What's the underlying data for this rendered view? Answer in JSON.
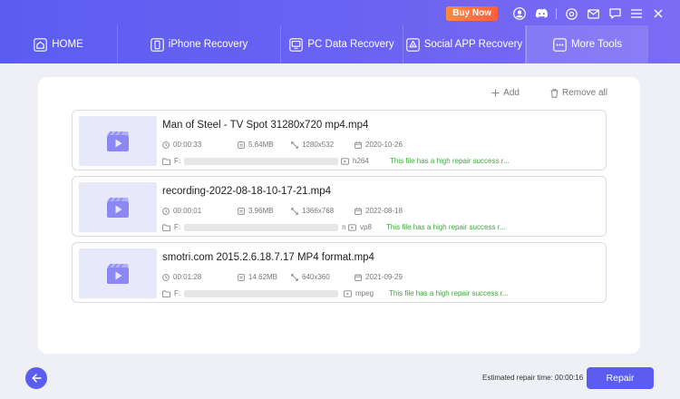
{
  "header": {
    "buy_now": "Buy Now",
    "icons": [
      "user-icon",
      "discord-icon",
      "settings-icon",
      "mail-icon",
      "feedback-icon",
      "menu-icon",
      "close-icon"
    ]
  },
  "tabs": [
    {
      "label": "HOME",
      "icon": "home-icon"
    },
    {
      "label": "iPhone Recovery",
      "icon": "iphone-icon"
    },
    {
      "label": "PC Data Recovery",
      "icon": "monitor-icon"
    },
    {
      "label": "Social APP Recovery",
      "icon": "social-app-icon"
    },
    {
      "label": "More Tools",
      "icon": "more-tools-icon",
      "active": true
    }
  ],
  "actions": {
    "add": "Add",
    "remove_all": "Remove all"
  },
  "files": [
    {
      "name": "Man of Steel - TV Spot 31280x720 mp4.mp4",
      "duration": "00:00:33",
      "size": "5.64MB",
      "resolution": "1280x532",
      "date": "2020-10-26",
      "path_prefix": "F:",
      "codec": "h264",
      "status": "This file has a high repair success r..."
    },
    {
      "name": "recording-2022-08-18-10-17-21.mp4",
      "duration": "00:00:01",
      "size": "3.96MB",
      "resolution": "1366x768",
      "date": "2022-08-18",
      "path_prefix": "F:",
      "path_suffix": "n",
      "codec": "vp8",
      "status": "This file has a high repair success r..."
    },
    {
      "name": "smotri.com 2015.2.6.18.7.17 MP4 format.mp4",
      "duration": "00:01:28",
      "size": "14.62MB",
      "resolution": "640x360",
      "date": "2021-09-29",
      "path_prefix": "F:",
      "codec": "mpeg",
      "status": "This file has a high repair success r..."
    }
  ],
  "footer": {
    "estimated_label": "Estimated repair time:",
    "estimated_value": "00:00:16",
    "repair": "Repair"
  },
  "colors": {
    "accent": "#5b5df0",
    "buy_now": "#ff6a3a",
    "success": "#3aa83a"
  }
}
